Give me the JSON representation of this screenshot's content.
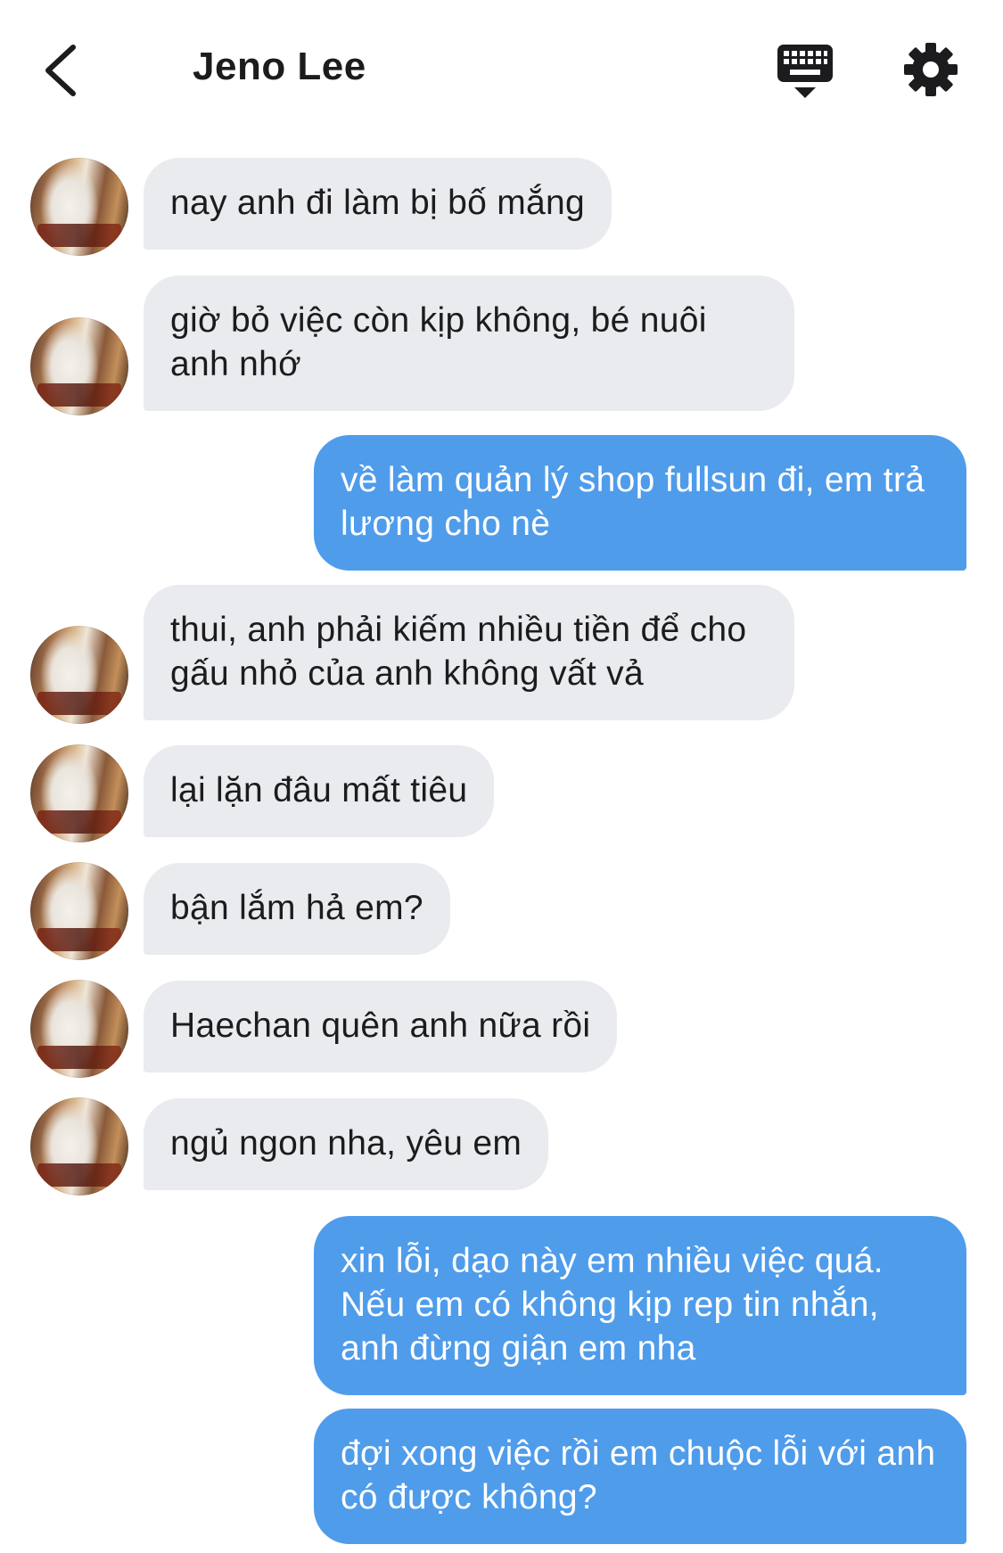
{
  "header": {
    "title": "Jeno Lee",
    "back_icon": "chevron-left-icon",
    "keyboard_icon": "keyboard-icon",
    "settings_icon": "gear-icon"
  },
  "colors": {
    "incoming_bubble": "#e9ebee",
    "outgoing_bubble": "#4f9ceb",
    "outgoing_text": "#ffffff",
    "incoming_text": "#1c1c1e"
  },
  "messages": [
    {
      "from": "them",
      "text": "nay anh đi làm bị bố mắng"
    },
    {
      "from": "them",
      "text": "giờ bỏ việc còn kịp không, bé nuôi anh nhớ"
    },
    {
      "from": "me",
      "text": "về làm quản lý shop fullsun đi, em trả lương cho nè"
    },
    {
      "from": "them",
      "text": "thui, anh phải kiếm nhiều tiền để cho gấu nhỏ của anh không vất vả"
    },
    {
      "from": "them",
      "text": "lại lặn đâu mất tiêu"
    },
    {
      "from": "them",
      "text": "bận lắm hả em?"
    },
    {
      "from": "them",
      "text": "Haechan quên anh nữa rồi"
    },
    {
      "from": "them",
      "text": "ngủ ngon nha, yêu em"
    },
    {
      "from": "me",
      "text": "xin lỗi, dạo này em nhiều việc quá. Nếu em có không kịp rep tin nhắn, anh đừng giận em nha"
    },
    {
      "from": "me",
      "text": "đợi xong việc rồi em chuộc lỗi với anh có được không?"
    }
  ]
}
